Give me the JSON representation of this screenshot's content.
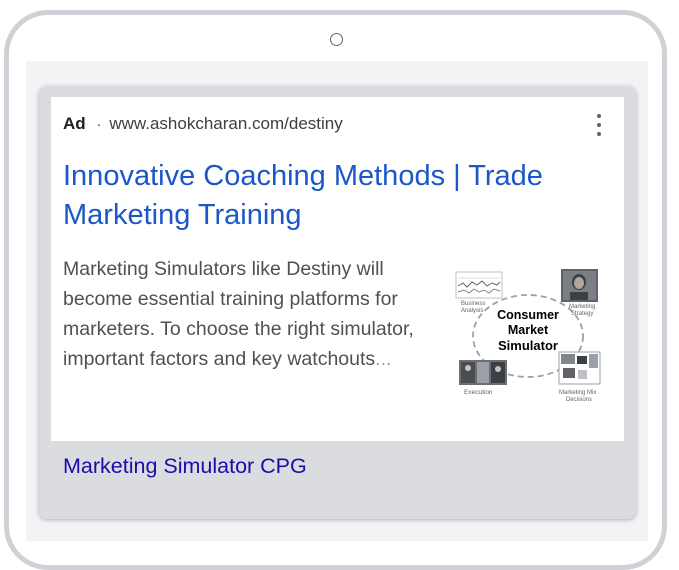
{
  "ad": {
    "label": "Ad",
    "separator": "·",
    "display_url": "www.ashokcharan.com/destiny",
    "title": "Innovative Coaching Methods | Trade Marketing Training",
    "description": "Marketing Simulators like Destiny will become essential training platforms for marketers. To choose the right simulator, important factors and key watchouts",
    "ellipsis": "...",
    "menu_icon": "more-vert-icon",
    "image": {
      "center_line1": "Consumer",
      "center_line2": "Market",
      "center_line3": "Simulator",
      "label_business_analysis_1": "Business",
      "label_business_analysis_2": "Analysis",
      "label_marketing_strategy_1": "Marketing",
      "label_marketing_strategy_2": "Strategy",
      "label_execution": "Execution",
      "label_mix_decisions_1": "Marketing Mix",
      "label_mix_decisions_2": "Decisions"
    },
    "sitelink": "Marketing Simulator CPG"
  },
  "colors": {
    "title_link": "#1a57c9",
    "sitelink": "#1a0dab",
    "card_background": "#dadce0",
    "text": "#4d5156"
  }
}
